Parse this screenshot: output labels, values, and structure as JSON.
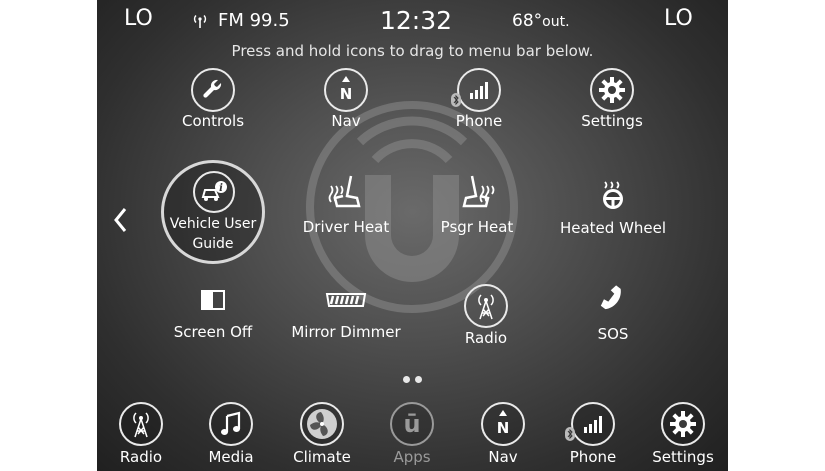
{
  "status_bar": {
    "left_climate": "LO",
    "right_climate": "LO",
    "radio_source": "FM 99.5",
    "clock": "12:32",
    "temperature": "68°",
    "temperature_suffix": "out."
  },
  "hint": "Press and hold icons to drag to menu bar below.",
  "apps_row1": [
    {
      "label": "Controls",
      "icon": "wrench-icon"
    },
    {
      "label": "Nav",
      "icon": "compass-icon",
      "glyph": "N"
    },
    {
      "label": "Phone",
      "icon": "phone-signal-icon"
    },
    {
      "label": "Settings",
      "icon": "gear-icon"
    }
  ],
  "apps_row2": [
    {
      "label": "Vehicle User",
      "label2": "Guide",
      "icon": "vehicle-info-icon"
    },
    {
      "label": "Driver Heat",
      "icon": "heated-seat-icon"
    },
    {
      "label": "Psgr Heat",
      "icon": "heated-seat-icon"
    },
    {
      "label": "Heated Wheel",
      "icon": "heated-wheel-icon"
    }
  ],
  "apps_row3": [
    {
      "label": "Screen Off",
      "icon": "screen-off-icon"
    },
    {
      "label": "Mirror Dimmer",
      "icon": "mirror-icon"
    },
    {
      "label": "Radio",
      "icon": "radio-tower-icon"
    },
    {
      "label": "SOS",
      "icon": "sos-phone-icon"
    }
  ],
  "pagination": {
    "pages": 2,
    "current": 1
  },
  "bottom_bar": [
    {
      "label": "Radio",
      "icon": "radio-tower-icon",
      "active": true
    },
    {
      "label": "Media",
      "icon": "music-note-icon",
      "active": true
    },
    {
      "label": "Climate",
      "icon": "fan-icon",
      "active": true
    },
    {
      "label": "Apps",
      "icon": "uconnect-icon",
      "glyph": "ū",
      "active": false
    },
    {
      "label": "Nav",
      "icon": "compass-icon",
      "glyph": "N",
      "active": true
    },
    {
      "label": "Phone",
      "icon": "phone-signal-icon",
      "active": true
    },
    {
      "label": "Settings",
      "icon": "gear-icon",
      "active": true
    }
  ],
  "colors": {
    "foreground": "#ffffff",
    "inactive": "#9a9a9a",
    "background": "#3a3a3a"
  }
}
